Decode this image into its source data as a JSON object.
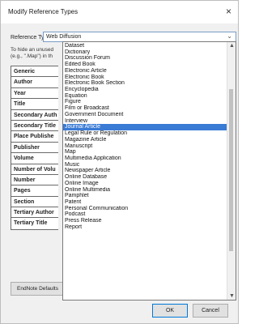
{
  "window": {
    "title": "Modify Reference Types",
    "close_glyph": "×"
  },
  "reference_type": {
    "label": "Reference Type:",
    "selected": "Web Diffusion",
    "chevron": "⌄"
  },
  "hint": {
    "line1": "To hide an unused",
    "line2": "(e.g., \".Map\") in th"
  },
  "fields": [
    "Generic",
    "Author",
    "Year",
    "Title",
    "Secondary Auth",
    "Secondary Title",
    "Place Publishe",
    "Publisher",
    "Volume",
    "Number of Volu",
    "Number",
    "Pages",
    "Section",
    "Tertiary Author",
    "Tertiary Title"
  ],
  "dropdown": {
    "items": [
      "Dataset",
      "Dictionary",
      "Discussion Forum",
      "Edited Book",
      "Electronic Article",
      "Electronic Book",
      "Electronic Book Section",
      "Encyclopedia",
      "Equation",
      "Figure",
      "Film or Broadcast",
      "Government Document",
      "Interview",
      "Journal Article",
      "Legal Rule or Regulation",
      "Magazine Article",
      "Manuscript",
      "Map",
      "Multimedia Application",
      "Music",
      "Newspaper Article",
      "Online Database",
      "Online Image",
      "Online Multimedia",
      "Pamphlet",
      "Patent",
      "Personal Communication",
      "Podcast",
      "Press Release",
      "Report"
    ],
    "selected_index": 13,
    "scroll_up": "▲",
    "scroll_down": "▼"
  },
  "buttons": {
    "endnote_defaults": "EndNote Defaults",
    "ok": "OK",
    "cancel": "Cancel"
  },
  "colors": {
    "selection": "#3a7bd5",
    "ok_border": "#0078d7"
  }
}
